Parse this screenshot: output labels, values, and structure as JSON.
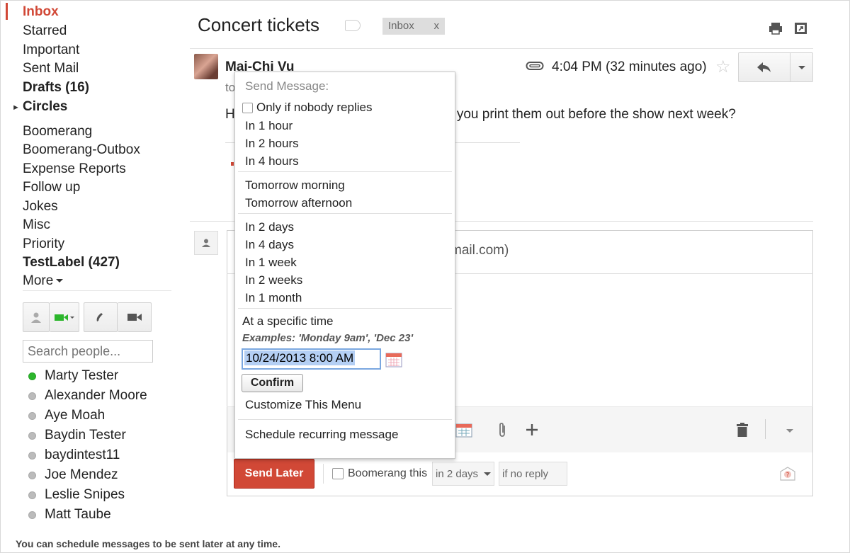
{
  "sidebar": {
    "nav": [
      {
        "label": "Inbox",
        "style": "inbox"
      },
      {
        "label": "Starred",
        "style": ""
      },
      {
        "label": "Important",
        "style": ""
      },
      {
        "label": "Sent Mail",
        "style": ""
      },
      {
        "label": "Drafts (16)",
        "style": "bold"
      },
      {
        "label": "Circles",
        "style": "bold"
      }
    ],
    "labels": [
      "Boomerang",
      "Boomerang-Outbox",
      "Expense Reports",
      "Follow up",
      "Jokes",
      "Misc",
      "Priority",
      "TestLabel (427)",
      "More"
    ],
    "search_placeholder": "Search people...",
    "contacts": [
      {
        "name": "Marty Tester",
        "status": "online"
      },
      {
        "name": "Alexander Moore",
        "status": "offline"
      },
      {
        "name": "Aye Moah",
        "status": "offline"
      },
      {
        "name": "Baydin Tester",
        "status": "offline"
      },
      {
        "name": "baydintest11",
        "status": "offline"
      },
      {
        "name": "Joe Mendez",
        "status": "offline"
      },
      {
        "name": "Leslie Snipes",
        "status": "offline"
      },
      {
        "name": "Matt Taube",
        "status": "offline"
      }
    ]
  },
  "thread": {
    "subject": "Concert tickets",
    "label_chip": "Inbox",
    "label_chip_close": "x"
  },
  "message": {
    "sender": "Mai-Chi Vu",
    "to_fragment": "to",
    "time": "4:04 PM (32 minutes ago)",
    "body_start": "H",
    "body_end": "n you print them out before the show next week?"
  },
  "compose": {
    "recipient_fragment": "mail.com)",
    "send_later_label": "Send Later",
    "boomerang_label": "Boomerang this",
    "boomerang_delay": "in 2 days",
    "boomerang_condition": "if no reply"
  },
  "menu": {
    "header": "Send Message:",
    "only_if_nobody_replies": "Only if nobody replies",
    "group1": [
      "In 1 hour",
      "In 2 hours",
      "In 4 hours"
    ],
    "group2": [
      "Tomorrow morning",
      "Tomorrow afternoon"
    ],
    "group3": [
      "In 2 days",
      "In 4 days",
      "In 1 week",
      "In 2 weeks",
      "In 1 month"
    ],
    "specific_time": "At a specific time",
    "examples": "Examples: 'Monday 9am', 'Dec 23'",
    "datetime_value": "10/24/2013 8:00 AM",
    "confirm_label": "Confirm",
    "customize": "Customize This Menu",
    "recurring": "Schedule recurring message"
  },
  "footer": "You can schedule messages to be sent later at any time.",
  "colors": {
    "accent_red": "#d14836",
    "online_green": "#2cb62c",
    "selection_blue": "#b4cff4"
  }
}
